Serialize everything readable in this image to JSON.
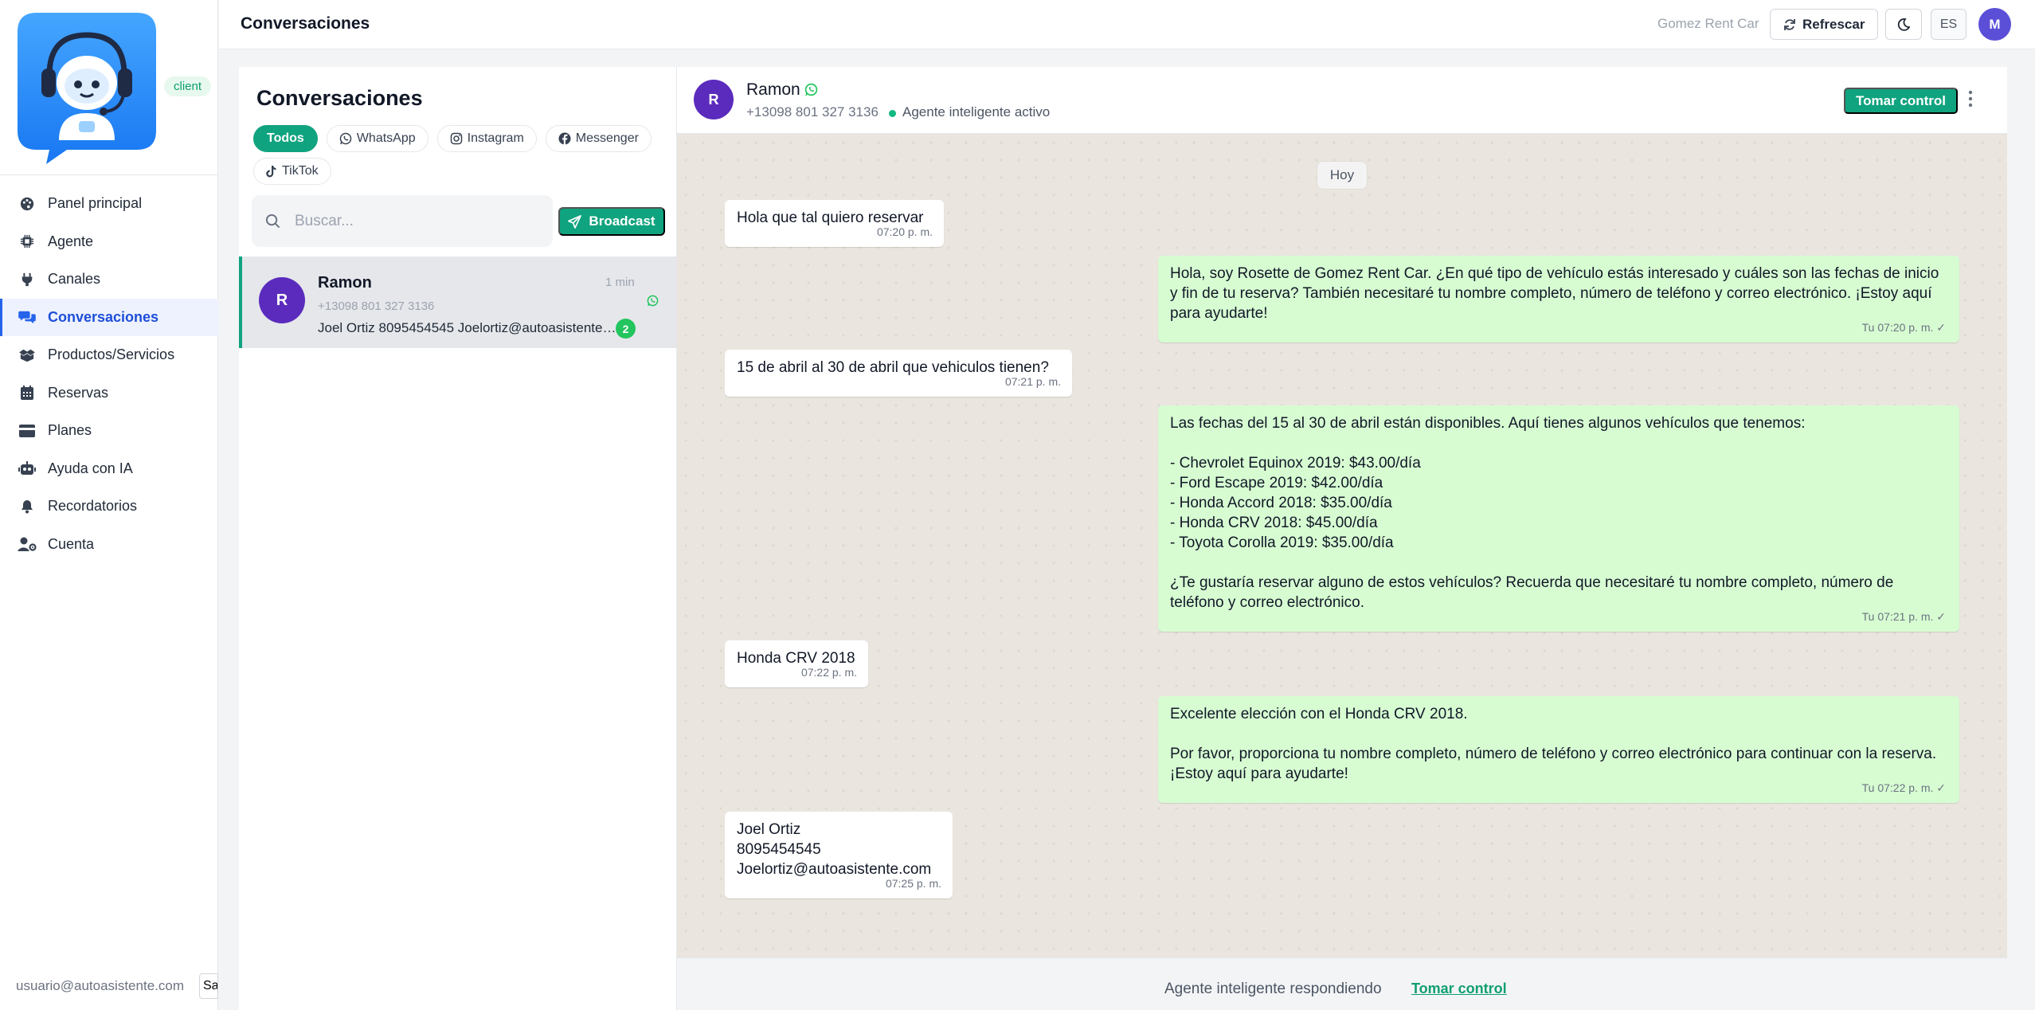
{
  "sidebar": {
    "role_badge": "client",
    "items": [
      {
        "label": "Panel principal",
        "icon": "palette-icon"
      },
      {
        "label": "Agente",
        "icon": "chip-icon"
      },
      {
        "label": "Canales",
        "icon": "plug-icon"
      },
      {
        "label": "Conversaciones",
        "icon": "chat-bubbles-icon",
        "active": true
      },
      {
        "label": "Productos/Servicios",
        "icon": "boxes-icon"
      },
      {
        "label": "Reservas",
        "icon": "calendar-icon"
      },
      {
        "label": "Planes",
        "icon": "credit-card-icon"
      },
      {
        "label": "Ayuda con IA",
        "icon": "robot-icon"
      },
      {
        "label": "Recordatorios",
        "icon": "bell-icon"
      },
      {
        "label": "Cuenta",
        "icon": "user-gear-icon"
      }
    ],
    "user_email": "usuario@autoasistente.com",
    "logout_label": "Sa"
  },
  "topbar": {
    "title": "Conversaciones",
    "company": "Gomez Rent Car",
    "refresh_label": "Refrescar",
    "lang": "ES",
    "avatar_initial": "M"
  },
  "conversations": {
    "title": "Conversaciones",
    "filters": [
      "Todos",
      "WhatsApp",
      "Instagram",
      "Messenger",
      "TikTok"
    ],
    "search_placeholder": "Buscar...",
    "broadcast_label": "Broadcast",
    "items": [
      {
        "initial": "R",
        "name": "Ramon",
        "time": "1 min",
        "phone": "+13098 801 327 3136",
        "preview": "Joel Ortiz 8095454545 Joelortiz@autoasistente.com",
        "unread": "2"
      }
    ]
  },
  "chat": {
    "initial": "R",
    "name": "Ramon",
    "phone": "+13098 801 327 3136",
    "agent_status": "Agente inteligente activo",
    "takeover_label": "Tomar control",
    "day_label": "Hoy",
    "messages": [
      {
        "dir": "in",
        "text": "Hola que tal quiero reservar",
        "time": "07:20 p. m."
      },
      {
        "dir": "out",
        "text": "Hola, soy Rosette de Gomez Rent Car. ¿En qué tipo de vehículo estás interesado y cuáles son las fechas de inicio y fin de tu reserva? También necesitaré tu nombre completo, número de teléfono y correo electrónico. ¡Estoy aquí para ayudarte!",
        "time": "Tu 07:20 p. m. ✓"
      },
      {
        "dir": "in",
        "text": "15 de abril al 30 de abril que vehiculos tienen?",
        "time": "07:21 p. m."
      },
      {
        "dir": "out",
        "text": "Las fechas del 15 al 30 de abril están disponibles. Aquí tienes algunos vehículos que tenemos:\n\n- Chevrolet Equinox 2019: $43.00/día\n- Ford Escape 2019: $42.00/día\n- Honda Accord 2018: $35.00/día\n- Honda CRV 2018: $45.00/día\n- Toyota Corolla 2019: $35.00/día\n\n¿Te gustaría reservar alguno de estos vehículos? Recuerda que necesitaré tu nombre completo, número de teléfono y correo electrónico.",
        "time": "Tu 07:21 p. m. ✓"
      },
      {
        "dir": "in",
        "text": "Honda CRV 2018",
        "time": "07:22 p. m."
      },
      {
        "dir": "out",
        "text": "Excelente elección con el Honda CRV 2018.\n\nPor favor, proporciona tu nombre completo, número de teléfono y correo electrónico para continuar con la reserva. ¡Estoy aquí para ayudarte!",
        "time": "Tu 07:22 p. m. ✓"
      },
      {
        "dir": "in",
        "text": "Joel Ortiz\n8095454545\nJoelortiz@autoasistente.com",
        "time": "07:25 p. m."
      }
    ],
    "footer_status": "Agente inteligente respondiendo",
    "footer_link": "Tomar control"
  },
  "colors": {
    "accent_green": "#10a37f",
    "active_nav": "#1d4ed8",
    "outgoing_bubble": "#d7fcd2",
    "chat_background": "#eae6df",
    "avatar_purple": "#5b2bbd"
  }
}
